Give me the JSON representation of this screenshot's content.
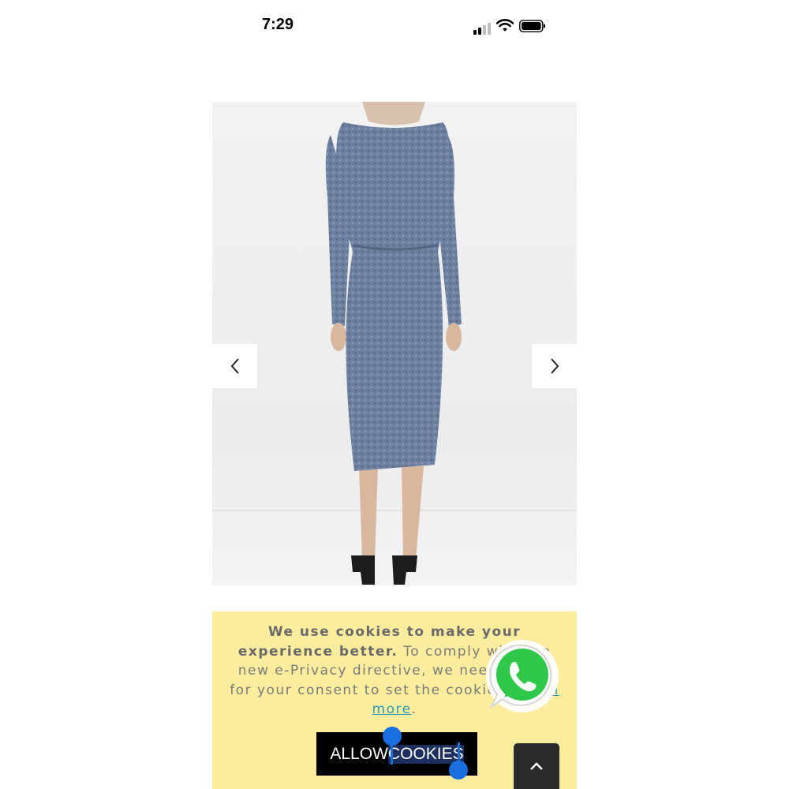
{
  "status_bar": {
    "time": "7:29",
    "icons": [
      "signal-icon",
      "wifi-icon",
      "battery-icon"
    ]
  },
  "product_gallery": {
    "image": "model-back-view-blue-textured-dress",
    "prev_icon": "chevron-left-icon",
    "next_icon": "chevron-right-icon"
  },
  "cookie_banner": {
    "text_bold": "We use cookies to make your experience better.",
    "text_body": " To comply with the new e-Privacy directive, we need to ask for your consent to set the cookies. ",
    "learn_more_label": "Learn more",
    "text_end": ".",
    "allow_label_part1": "ALLOW",
    "allow_label_part2": "COOKIES",
    "background_color": "#fcec9e"
  },
  "floating": {
    "whatsapp_icon": "whatsapp-icon",
    "scroll_top_icon": "chevron-up-icon"
  },
  "colors": {
    "dress": "#6c7f9e",
    "link": "#2a9bb7",
    "selection": "#1a6fe0"
  }
}
